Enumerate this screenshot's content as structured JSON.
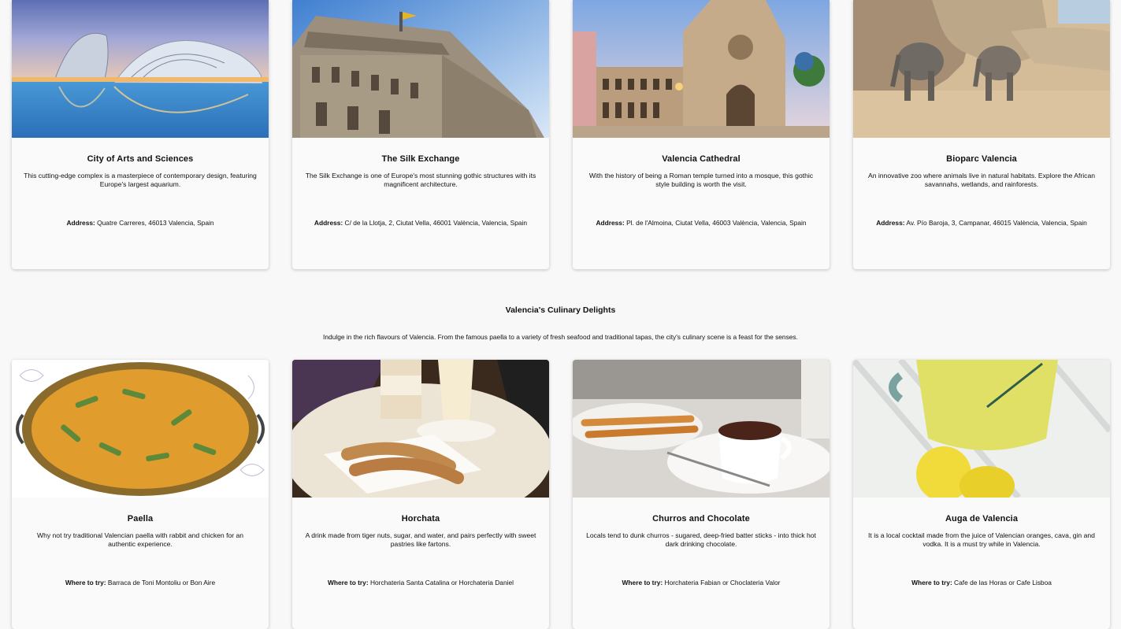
{
  "attractions": [
    {
      "title": "City of Arts and Sciences",
      "description": "This cutting-edge complex is a masterpiece of contemporary design, featuring Europe's largest aquarium.",
      "address_label": "Address:",
      "address": " Quatre Carreres, 46013 Valencia, Spain",
      "image": "city-of-arts-and-sciences-photo"
    },
    {
      "title": "The Silk Exchange",
      "description": "The Silk Exchange is one of Europe's most stunning gothic structures with its magnificent architecture.",
      "address_label": "Address:",
      "address": " C/ de la Llotja, 2, Ciutat Vella, 46001 València, Valencia, Spain",
      "image": "silk-exchange-photo"
    },
    {
      "title": "Valencia Cathedral",
      "description": "With the history of being a Roman temple turned into a mosque, this gothic style building is worth the visit.",
      "address_label": "Address:",
      "address": " Pl. de l'Almoina, Ciutat Vella, 46003 València, Valencia, Spain",
      "image": "valencia-cathedral-photo"
    },
    {
      "title": "Bioparc Valencia",
      "description": "An innovative zoo where animals live in natural habitats. Explore the African savannahs, wetlands, and rainforests.",
      "address_label": "Address:",
      "address": " Av. Pío Baroja, 3, Campanar, 46015 València, Valencia, Spain",
      "image": "bioparc-elephants-photo"
    }
  ],
  "culinary": {
    "title": "Valencia's Culinary Delights",
    "intro": "Indulge in the rich flavours of Valencia. From the famous paella to a variety of fresh seafood and traditional tapas, the city's culinary scene is a feast for the senses.",
    "items": [
      {
        "title": "Paella",
        "description": "Why not try traditional Valencian paella with rabbit and chicken for an authentic experience.",
        "where_label": "Where to try:",
        "where": " Barraca de Toni Montoliu or Bon Aire",
        "image": "paella-photo"
      },
      {
        "title": "Horchata",
        "description": "A drink made from tiger nuts, sugar, and water, and pairs perfectly with sweet pastries like fartons.",
        "where_label": "Where to try:",
        "where": " Horchateria Santa Catalina or Horchateria Daniel",
        "image": "horchata-photo"
      },
      {
        "title": "Churros and Chocolate",
        "description": "Locals tend to dunk churros - sugared, deep-fried batter sticks - into thick hot dark drinking chocolate.",
        "where_label": "Where to try:",
        "where": " Horchateria Fabian or Choclateria Valor",
        "image": "churros-chocolate-photo"
      },
      {
        "title": "Auga de Valencia",
        "description": "It is a local cocktail made from the juice of Valencian oranges, cava, gin and vodka. It is a must try while in Valencia.",
        "where_label": "Where to try:",
        "where": " Cafe de las Horas or Cafe Lisboa",
        "image": "agua-de-valencia-photo"
      }
    ]
  }
}
